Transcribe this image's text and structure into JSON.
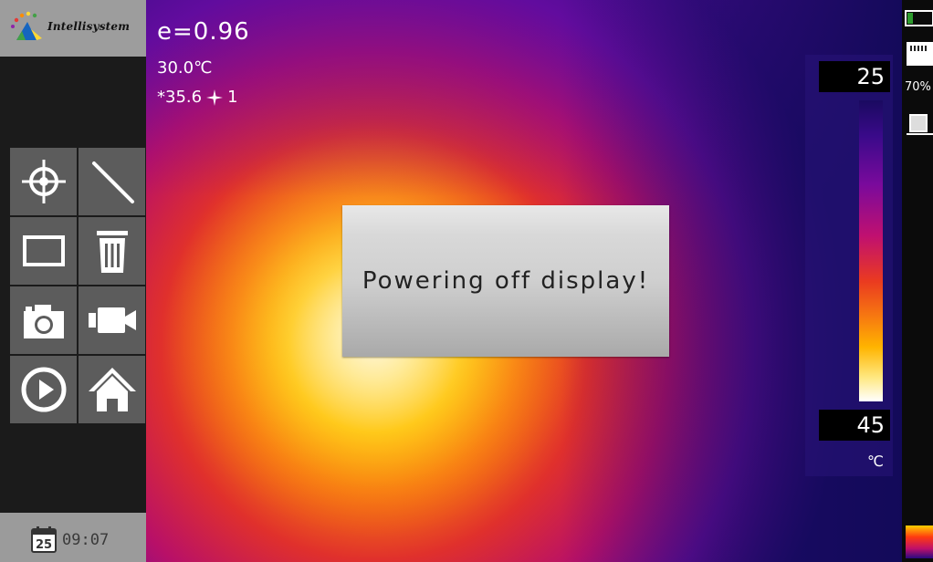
{
  "brand": {
    "logo_text": "Intellisystem"
  },
  "readouts": {
    "emissivity": "e=0.96",
    "reflected_temp": "30.0℃",
    "spot_prefix": "*35.6",
    "spot_index": "1"
  },
  "scale": {
    "max": "25",
    "min": "45",
    "unit": "℃"
  },
  "dialog": {
    "message": "Powering off display!"
  },
  "status": {
    "storage": "70%"
  },
  "datetime": {
    "day": "25",
    "time": "09:07"
  },
  "tools": [
    {
      "id": "spot-measure",
      "icon": "crosshair-icon"
    },
    {
      "id": "line-measure",
      "icon": "line-icon"
    },
    {
      "id": "area-measure",
      "icon": "rectangle-icon"
    },
    {
      "id": "delete",
      "icon": "trash-icon"
    },
    {
      "id": "photo",
      "icon": "camera-icon"
    },
    {
      "id": "video",
      "icon": "video-camera-icon"
    },
    {
      "id": "playback",
      "icon": "play-icon"
    },
    {
      "id": "home",
      "icon": "home-icon"
    }
  ],
  "colors": {
    "thermal_palette": [
      "#1a0a60",
      "#7a0a9c",
      "#c01070",
      "#ea3a20",
      "#ffb400",
      "#ffffff"
    ],
    "sidebar_bg": "#1b1b1b",
    "tool_bg": "#5c5c5c"
  }
}
